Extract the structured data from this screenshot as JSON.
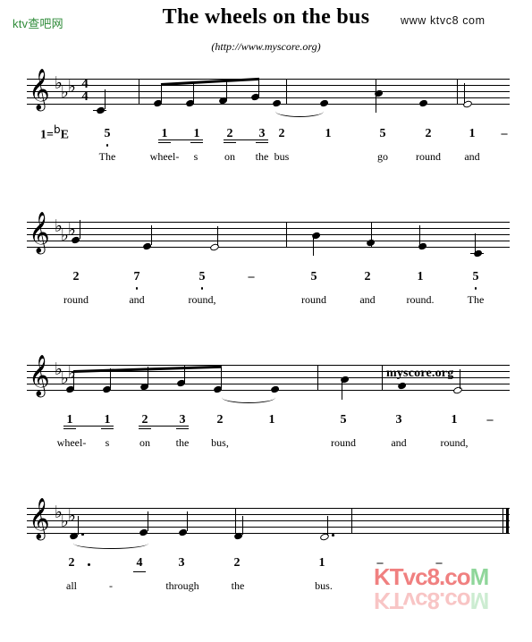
{
  "header": {
    "logo_left": "ktv查吧网",
    "logo_right": "www ktvc8 com",
    "title": "The wheels on the bus",
    "subtitle": "(http://www.myscore.org)"
  },
  "score": {
    "key_signature_label": "1=",
    "key_flat": "b",
    "key_letter": "E",
    "time_signature": {
      "beats": "4",
      "unit": "4"
    },
    "clef": "treble-clef",
    "flats_count": 3,
    "watermark_middle": "myscore.org",
    "watermark_bottom": "KTvc8.coM",
    "watermark_bottom_red": "KTvc8.co",
    "watermark_bottom_green": "M"
  },
  "systems": [
    {
      "index": 1,
      "notes": [
        {
          "num": "5",
          "lyric": "The",
          "octave": "low",
          "beam": false
        },
        {
          "num": "1",
          "lyric": "wheel-",
          "octave": "mid",
          "beam": true
        },
        {
          "num": "1",
          "lyric": "s",
          "octave": "mid",
          "beam": true
        },
        {
          "num": "2",
          "lyric": "on",
          "octave": "mid",
          "beam": true
        },
        {
          "num": "3",
          "lyric": "the",
          "octave": "mid",
          "beam": true
        },
        {
          "num": "2",
          "lyric": "bus",
          "octave": "mid",
          "beam": false
        },
        {
          "num": "1",
          "lyric": "",
          "octave": "mid",
          "beam": false
        },
        {
          "num": "5",
          "lyric": "go",
          "octave": "mid",
          "beam": false
        },
        {
          "num": "2",
          "lyric": "round",
          "octave": "mid",
          "beam": false
        },
        {
          "num": "1",
          "lyric": "and",
          "octave": "mid",
          "beam": false
        },
        {
          "num": "–",
          "lyric": "",
          "octave": "mid",
          "beam": false
        }
      ]
    },
    {
      "index": 2,
      "notes": [
        {
          "num": "2",
          "lyric": "round",
          "octave": "mid"
        },
        {
          "num": "7",
          "lyric": "and",
          "octave": "low"
        },
        {
          "num": "5",
          "lyric": "round,",
          "octave": "low"
        },
        {
          "num": "–",
          "lyric": "",
          "octave": "mid"
        },
        {
          "num": "5",
          "lyric": "round",
          "octave": "mid"
        },
        {
          "num": "2",
          "lyric": "and",
          "octave": "mid"
        },
        {
          "num": "1",
          "lyric": "round.",
          "octave": "mid"
        },
        {
          "num": "5",
          "lyric": "The",
          "octave": "low"
        }
      ]
    },
    {
      "index": 3,
      "notes": [
        {
          "num": "1",
          "lyric": "wheel-",
          "octave": "mid",
          "beam": true
        },
        {
          "num": "1",
          "lyric": "s",
          "octave": "mid",
          "beam": true
        },
        {
          "num": "2",
          "lyric": "on",
          "octave": "mid",
          "beam": true
        },
        {
          "num": "3",
          "lyric": "the",
          "octave": "mid",
          "beam": true
        },
        {
          "num": "2",
          "lyric": "bus,",
          "octave": "mid",
          "beam": false
        },
        {
          "num": "1",
          "lyric": "",
          "octave": "mid",
          "beam": false
        },
        {
          "num": "5",
          "lyric": "round",
          "octave": "mid",
          "beam": false
        },
        {
          "num": "3",
          "lyric": "and",
          "octave": "mid",
          "beam": false
        },
        {
          "num": "1",
          "lyric": "round,",
          "octave": "mid",
          "beam": false
        },
        {
          "num": "–",
          "lyric": "",
          "octave": "mid",
          "beam": false
        }
      ]
    },
    {
      "index": 4,
      "notes": [
        {
          "num": "2",
          "lyric": "all",
          "octave": "mid",
          "dotted": true
        },
        {
          "num": "·",
          "lyric": "-",
          "octave": "mid"
        },
        {
          "num": "4",
          "lyric": "through",
          "octave": "mid",
          "beam": true
        },
        {
          "num": "3",
          "lyric": "the",
          "octave": "mid"
        },
        {
          "num": "2",
          "lyric": "",
          "octave": "mid"
        },
        {
          "num": "1",
          "lyric": "bus.",
          "octave": "mid"
        },
        {
          "num": "–",
          "lyric": "",
          "octave": "mid"
        },
        {
          "num": "–",
          "lyric": "",
          "octave": "mid"
        }
      ]
    }
  ],
  "chart_data": {
    "type": "table",
    "title": "The wheels on the bus",
    "subtitle": "(http://www.myscore.org)",
    "key": "1=bE",
    "time_signature": "4/4",
    "notation": "jianpu-with-staff",
    "columns": [
      "system",
      "solfege_number",
      "octave",
      "lyric"
    ],
    "rows": [
      [
        1,
        "5",
        "low",
        "The"
      ],
      [
        1,
        "1",
        "mid",
        "wheel-"
      ],
      [
        1,
        "1",
        "mid",
        "s"
      ],
      [
        1,
        "2",
        "mid",
        "on"
      ],
      [
        1,
        "3",
        "mid",
        "the"
      ],
      [
        1,
        "2",
        "mid",
        "bus"
      ],
      [
        1,
        "1",
        "mid",
        ""
      ],
      [
        1,
        "5",
        "mid",
        "go"
      ],
      [
        1,
        "2",
        "mid",
        "round"
      ],
      [
        1,
        "1",
        "mid",
        "and"
      ],
      [
        1,
        "-",
        "mid",
        ""
      ],
      [
        2,
        "2",
        "mid",
        "round"
      ],
      [
        2,
        "7",
        "low",
        "and"
      ],
      [
        2,
        "5",
        "low",
        "round,"
      ],
      [
        2,
        "-",
        "mid",
        ""
      ],
      [
        2,
        "5",
        "mid",
        "round"
      ],
      [
        2,
        "2",
        "mid",
        "and"
      ],
      [
        2,
        "1",
        "mid",
        "round."
      ],
      [
        2,
        "5",
        "low",
        "The"
      ],
      [
        3,
        "1",
        "mid",
        "wheel-"
      ],
      [
        3,
        "1",
        "mid",
        "s"
      ],
      [
        3,
        "2",
        "mid",
        "on"
      ],
      [
        3,
        "3",
        "mid",
        "the"
      ],
      [
        3,
        "2",
        "mid",
        "bus,"
      ],
      [
        3,
        "1",
        "mid",
        ""
      ],
      [
        3,
        "5",
        "mid",
        "round"
      ],
      [
        3,
        "3",
        "mid",
        "and"
      ],
      [
        3,
        "1",
        "mid",
        "round,"
      ],
      [
        3,
        "-",
        "mid",
        ""
      ],
      [
        4,
        "2.",
        "mid",
        "all"
      ],
      [
        4,
        "4",
        "mid",
        "through"
      ],
      [
        4,
        "3",
        "mid",
        "the"
      ],
      [
        4,
        "2",
        "mid",
        ""
      ],
      [
        4,
        "1",
        "mid",
        "bus."
      ],
      [
        4,
        "-",
        "mid",
        ""
      ],
      [
        4,
        "-",
        "mid",
        ""
      ]
    ]
  }
}
